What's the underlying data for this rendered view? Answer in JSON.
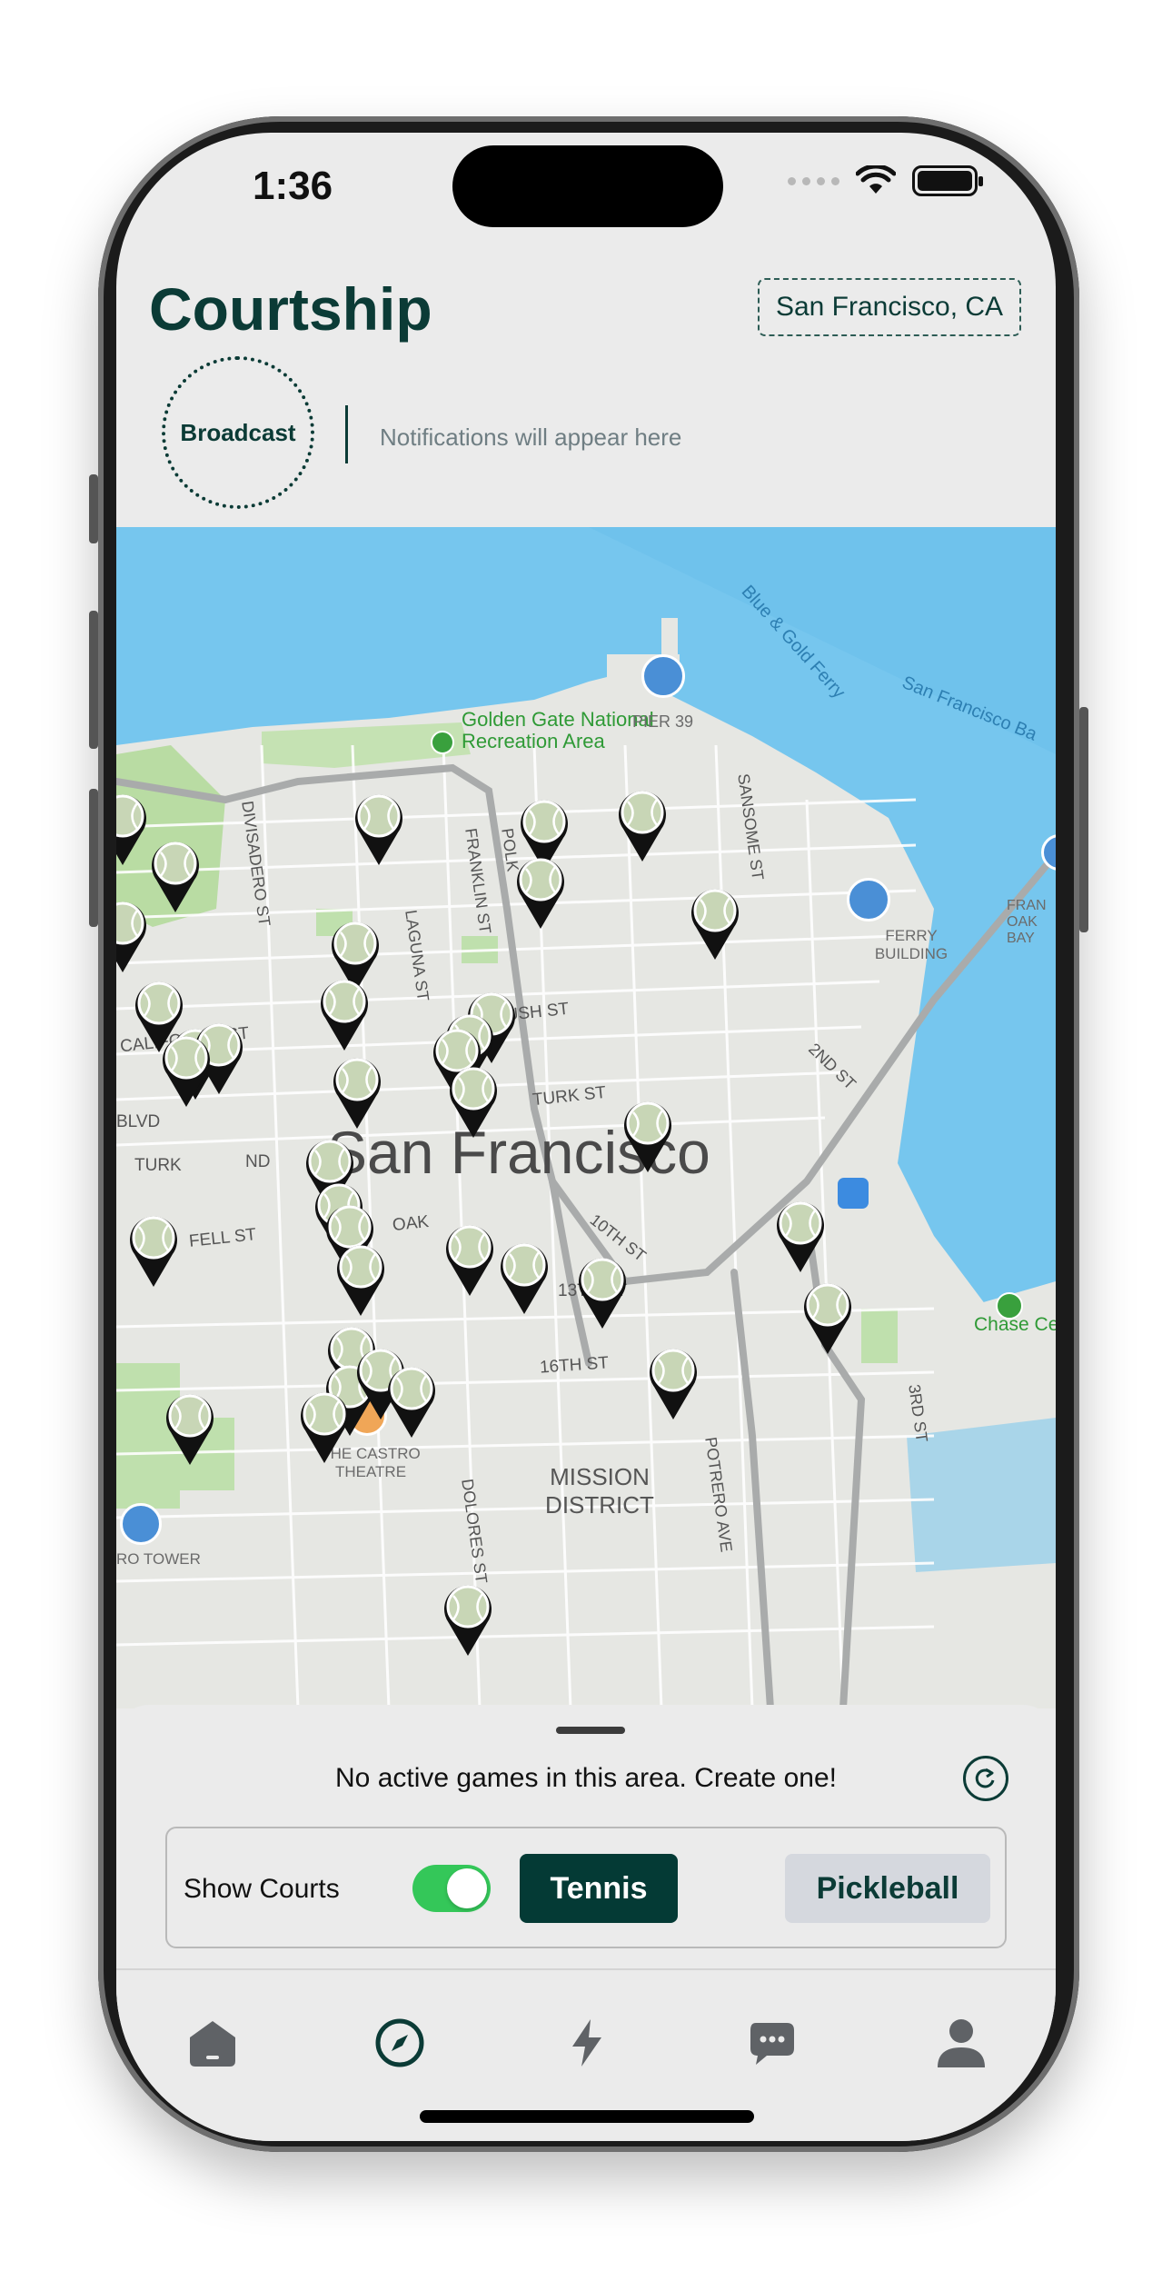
{
  "status_bar": {
    "time": "1:36"
  },
  "header": {
    "app_title": "Courtship",
    "location": "San Francisco, CA"
  },
  "broadcast": {
    "button_label": "Broadcast",
    "notifications_placeholder": "Notifications will appear here"
  },
  "map": {
    "city_label": "San Francisco",
    "poi_labels": {
      "park": "Golden Gate National Recreation Area",
      "pier": "PIER 39",
      "ferry": "FERRY BUILDING",
      "castro": "THE CASTRO THEATRE",
      "tower": "RO TOWER",
      "chase": "Chase Ce",
      "bay_oak": "FRAN OAK BAY",
      "mission": "MISSION DISTRICT"
    },
    "water_labels": [
      "Blue & Gold Ferry",
      "San Francisco Ba"
    ],
    "street_labels": [
      "DIVISADERO ST",
      "FRANKLIN ST",
      "LAGUNA ST",
      "POLK",
      "SANSOME ST",
      "CALIFORNIA ST",
      "BUSH ST",
      "TURK ST",
      "BLVD",
      "TURK",
      "ND",
      "FELL ST",
      "OAK",
      "10TH ST",
      "13TH ST",
      "16TH ST",
      "2ND ST",
      "POTRERO AVE",
      "3RD ST",
      "DOLORES ST"
    ]
  },
  "sheet": {
    "empty_message": "No active games in this area. Create one!",
    "show_courts_label": "Show Courts",
    "show_courts_on": true,
    "tennis_label": "Tennis",
    "pickleball_label": "Pickleball"
  },
  "tabs": [
    "home-icon",
    "compass-icon",
    "bolt-icon",
    "chat-icon",
    "profile-icon"
  ],
  "colors": {
    "brand": "#0b3b36",
    "toggle_on": "#34c759",
    "water": "#76c6ee",
    "pin_ball": "#c8d6b6"
  }
}
